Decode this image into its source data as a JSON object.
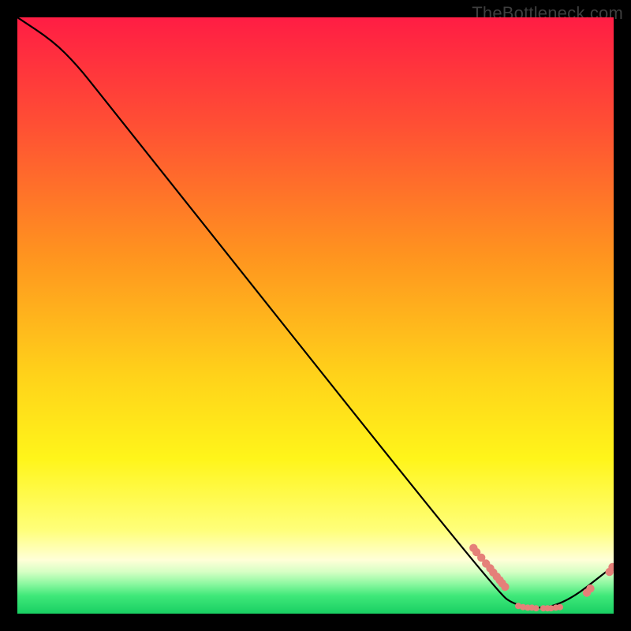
{
  "watermark": "TheBottleneck.com",
  "colors": {
    "accent_red": "#ff1d44",
    "accent_orange": "#ffa31a",
    "accent_yellow": "#fff51a",
    "accent_paleyellow": "#ffffb0",
    "accent_green": "#1fe06b",
    "curve": "#000000",
    "marker": "#e58079",
    "background": "#000000"
  },
  "chart_data": {
    "type": "line",
    "title": "",
    "xlabel": "",
    "ylabel": "",
    "xlim": [
      0,
      100
    ],
    "ylim": [
      0,
      100
    ],
    "grid": false,
    "legend": false,
    "curve": [
      {
        "x": 0,
        "y": 100
      },
      {
        "x": 6,
        "y": 96
      },
      {
        "x": 10,
        "y": 92
      },
      {
        "x": 14,
        "y": 87
      },
      {
        "x": 80,
        "y": 4
      },
      {
        "x": 84,
        "y": 1
      },
      {
        "x": 91,
        "y": 1
      },
      {
        "x": 100,
        "y": 8
      }
    ],
    "descending_cluster": [
      {
        "x": 76.5,
        "y": 11.0
      },
      {
        "x": 77.0,
        "y": 10.3
      },
      {
        "x": 77.8,
        "y": 9.4
      },
      {
        "x": 78.6,
        "y": 8.4
      },
      {
        "x": 79.3,
        "y": 7.6
      },
      {
        "x": 79.8,
        "y": 6.9
      },
      {
        "x": 80.4,
        "y": 6.2
      },
      {
        "x": 80.9,
        "y": 5.6
      },
      {
        "x": 81.3,
        "y": 5.1
      },
      {
        "x": 81.8,
        "y": 4.5
      }
    ],
    "floor_cluster": [
      {
        "x": 84.0,
        "y": 1.3
      },
      {
        "x": 84.8,
        "y": 1.1
      },
      {
        "x": 85.6,
        "y": 1.0
      },
      {
        "x": 86.3,
        "y": 1.0
      },
      {
        "x": 87.0,
        "y": 0.9
      },
      {
        "x": 88.2,
        "y": 0.9
      },
      {
        "x": 88.9,
        "y": 0.9
      },
      {
        "x": 89.5,
        "y": 0.9
      },
      {
        "x": 90.3,
        "y": 1.0
      },
      {
        "x": 91.0,
        "y": 1.1
      }
    ],
    "ascending_cluster": [
      {
        "x": 95.5,
        "y": 3.5
      },
      {
        "x": 96.1,
        "y": 4.2
      },
      {
        "x": 99.3,
        "y": 7.0
      },
      {
        "x": 99.8,
        "y": 7.8
      }
    ]
  }
}
